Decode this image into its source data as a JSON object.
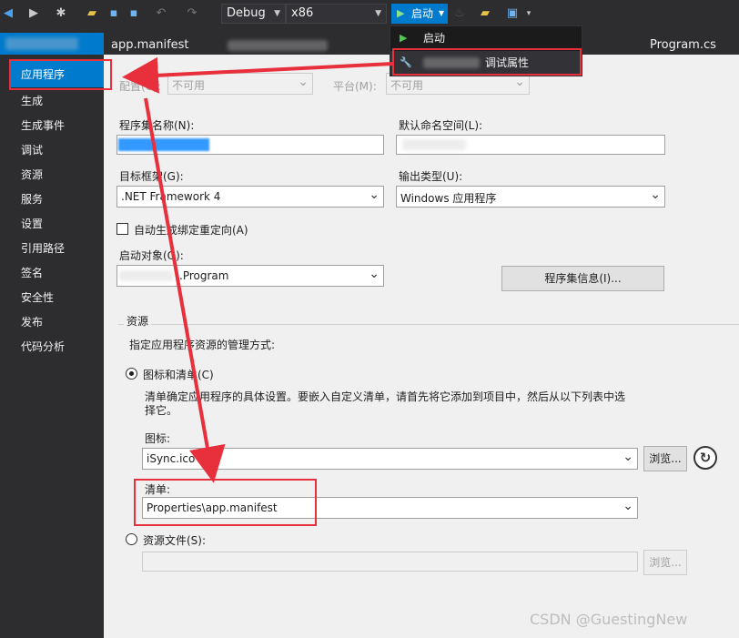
{
  "toolbar": {
    "config": "Debug",
    "platform": "x86",
    "start_label": "启动"
  },
  "tabs": [
    "app.manifest",
    "Program.cs"
  ],
  "nav": {
    "items": [
      "应用程序",
      "生成",
      "生成事件",
      "调试",
      "资源",
      "服务",
      "设置",
      "引用路径",
      "签名",
      "安全性",
      "发布",
      "代码分析"
    ]
  },
  "menu": {
    "item_start": "启动",
    "item_debug_props": "调试属性"
  },
  "form": {
    "config_label": "配置(C):",
    "config_value": "不可用",
    "platform_label": "平台(M):",
    "platform_value": "不可用",
    "assembly_name_label": "程序集名称(N):",
    "default_ns_label": "默认命名空间(L):",
    "target_fw_label": "目标框架(G):",
    "target_fw_value": ".NET Framework 4",
    "output_type_label": "输出类型(U):",
    "output_type_value": "Windows 应用程序",
    "auto_binding_label": "自动生成绑定重定向(A)",
    "startup_obj_label": "启动对象(O):",
    "startup_obj_value": ".Program",
    "assembly_info_btn": "程序集信息(I)...",
    "resources_group": "资源",
    "resources_desc": "指定应用程序资源的管理方式:",
    "icon_manifest_radio": "图标和清单(C)",
    "manifest_desc_line1": "清单确定应用程序的具体设置。要嵌入自定义清单，请首先将它添加到项目中，然后从以下列表中选",
    "manifest_desc_line2": "择它。",
    "icon_label": "图标:",
    "icon_value": "iSync.ico",
    "browse_btn": "浏览...",
    "manifest_label": "清单:",
    "manifest_value": "Properties\\app.manifest",
    "resource_file_radio": "资源文件(S):",
    "browse_btn2": "浏览..."
  },
  "watermark": "CSDN @GuestingNew",
  "colors": {
    "accent": "#007acc",
    "annotation": "#e8303c"
  }
}
